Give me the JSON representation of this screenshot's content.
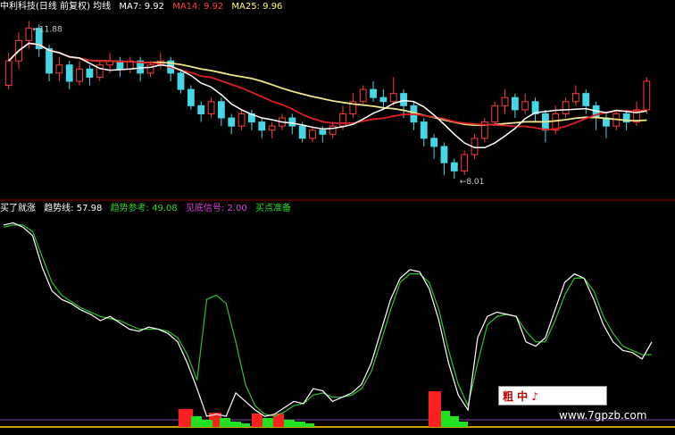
{
  "header": {
    "title": "中利科技(日线 前复权) 均线",
    "ma7": "MA7: 9.92",
    "ma14": "MA14: 9.92",
    "ma25": "MA25: 9.96",
    "high_label": "11.88",
    "low_label": "8.01"
  },
  "indicator_header": {
    "name": "买了就涨",
    "trend_line": "趋势线: 57.98",
    "trend_ref": "趋势参考: 49.08",
    "signal": "见底信号: 2.00",
    "buy_prepare": "买点准备"
  },
  "watermark": {
    "logo": "粗 中 ♪",
    "url": "www.7gpzb.com"
  },
  "colors": {
    "up": "#ff3b3b",
    "down": "#45d7e6",
    "ma7": "#ffffff",
    "ma14": "#e02020",
    "ma25": "#f0e68c",
    "trend_line": "#ffffff",
    "trend_ref": "#30c030",
    "signal_red": "#ff2020",
    "signal_green": "#20e020",
    "header_title": "#ffffff",
    "header_ma14": "#ff4040",
    "header_ma25": "#ffff66",
    "ind_name": "#ffffff",
    "ind_trend_ref": "#30d030",
    "ind_signal": "#e040e0",
    "ind_buy": "#20e020"
  },
  "chart_data": [
    {
      "type": "candlestick",
      "title": "中利科技(日线 前复权) 均线",
      "series": [
        {
          "name": "MA7",
          "value": 9.92
        },
        {
          "name": "MA14",
          "value": 9.92
        },
        {
          "name": "MA25",
          "value": 9.96
        }
      ],
      "annotations": [
        {
          "text": "11.88",
          "kind": "high"
        },
        {
          "text": "8.01",
          "kind": "low"
        }
      ],
      "ylim": [
        7.9,
        12.0
      ],
      "candles": [
        [
          10.3,
          10.9,
          11.1,
          10.2
        ],
        [
          10.9,
          11.4,
          11.6,
          10.7
        ],
        [
          11.4,
          11.7,
          11.88,
          11.2
        ],
        [
          11.7,
          11.2,
          11.8,
          11.0
        ],
        [
          11.2,
          10.6,
          11.3,
          10.4
        ],
        [
          10.6,
          10.8,
          11.0,
          10.4
        ],
        [
          10.8,
          10.4,
          10.9,
          10.2
        ],
        [
          10.4,
          10.7,
          10.9,
          10.3
        ],
        [
          10.7,
          10.5,
          10.8,
          10.3
        ],
        [
          10.5,
          10.8,
          10.9,
          10.4
        ],
        [
          10.8,
          10.9,
          11.1,
          10.6
        ],
        [
          10.9,
          10.7,
          11.0,
          10.5
        ],
        [
          10.7,
          10.9,
          11.0,
          10.6
        ],
        [
          10.9,
          10.6,
          11.0,
          10.4
        ],
        [
          10.6,
          10.8,
          10.9,
          10.5
        ],
        [
          10.8,
          10.9,
          11.1,
          10.7
        ],
        [
          10.9,
          10.6,
          11.0,
          10.4
        ],
        [
          10.6,
          10.2,
          10.7,
          10.1
        ],
        [
          10.2,
          9.8,
          10.3,
          9.7
        ],
        [
          9.8,
          9.6,
          9.9,
          9.4
        ],
        [
          9.6,
          9.9,
          10.0,
          9.5
        ],
        [
          9.9,
          9.5,
          10.0,
          9.3
        ],
        [
          9.5,
          9.3,
          9.6,
          9.1
        ],
        [
          9.3,
          9.6,
          9.7,
          9.2
        ],
        [
          9.6,
          9.4,
          9.7,
          9.2
        ],
        [
          9.4,
          9.2,
          9.5,
          9.0
        ],
        [
          9.2,
          9.3,
          9.4,
          9.0
        ],
        [
          9.3,
          9.5,
          9.6,
          9.2
        ],
        [
          9.5,
          9.3,
          9.6,
          9.1
        ],
        [
          9.3,
          9.0,
          9.4,
          8.9
        ],
        [
          9.0,
          9.2,
          9.3,
          8.9
        ],
        [
          9.2,
          9.1,
          9.3,
          8.9
        ],
        [
          9.1,
          9.3,
          9.4,
          9.0
        ],
        [
          9.3,
          9.6,
          9.8,
          9.2
        ],
        [
          9.6,
          9.9,
          10.1,
          9.5
        ],
        [
          9.9,
          10.2,
          10.3,
          9.8
        ],
        [
          10.2,
          10.0,
          10.4,
          9.9
        ],
        [
          10.0,
          9.9,
          10.2,
          9.7
        ],
        [
          9.9,
          10.1,
          10.5,
          9.8
        ],
        [
          10.1,
          9.8,
          10.2,
          9.5
        ],
        [
          9.8,
          9.4,
          9.9,
          9.2
        ],
        [
          9.4,
          9.0,
          9.5,
          8.8
        ],
        [
          9.0,
          8.8,
          9.1,
          8.5
        ],
        [
          8.8,
          8.4,
          8.9,
          8.1
        ],
        [
          8.4,
          8.2,
          8.5,
          8.01
        ],
        [
          8.2,
          8.6,
          8.7,
          8.1
        ],
        [
          8.6,
          9.0,
          9.1,
          8.5
        ],
        [
          9.0,
          9.4,
          9.5,
          8.9
        ],
        [
          9.4,
          9.8,
          9.9,
          9.3
        ],
        [
          9.8,
          10.0,
          10.2,
          9.6
        ],
        [
          10.0,
          9.7,
          10.1,
          9.5
        ],
        [
          9.7,
          9.9,
          10.1,
          9.6
        ],
        [
          9.9,
          9.6,
          10.0,
          9.4
        ],
        [
          9.6,
          9.2,
          9.7,
          8.9
        ],
        [
          9.2,
          9.6,
          9.8,
          9.1
        ],
        [
          9.6,
          9.9,
          10.0,
          9.5
        ],
        [
          9.9,
          10.1,
          10.3,
          9.8
        ],
        [
          10.1,
          9.8,
          10.2,
          9.6
        ],
        [
          9.8,
          9.5,
          9.9,
          9.2
        ],
        [
          9.5,
          9.3,
          9.6,
          9.0
        ],
        [
          9.3,
          9.6,
          9.7,
          9.2
        ],
        [
          9.6,
          9.4,
          9.7,
          9.2
        ],
        [
          9.4,
          9.7,
          9.9,
          9.3
        ],
        [
          9.7,
          10.4,
          10.5,
          9.6
        ]
      ]
    },
    {
      "type": "line",
      "title": "买了就涨",
      "series": [
        {
          "name": "趋势线",
          "value": 57.98
        },
        {
          "name": "趋势参考",
          "value": 49.08
        },
        {
          "name": "见底信号",
          "value": 2.0
        },
        {
          "name": "买点准备"
        }
      ],
      "ylim": [
        0,
        100
      ],
      "trend": [
        95,
        96,
        94,
        90,
        75,
        64,
        60,
        58,
        55,
        53,
        50,
        52,
        49,
        46,
        45,
        47,
        46,
        44,
        40,
        30,
        18,
        5,
        6,
        5,
        16,
        12,
        8,
        5,
        6,
        9,
        12,
        11,
        18,
        17,
        12,
        14,
        16,
        20,
        30,
        45,
        60,
        70,
        74,
        73,
        65,
        50,
        30,
        15,
        8,
        42,
        52,
        54,
        53,
        52,
        40,
        38,
        42,
        55,
        68,
        72,
        70,
        60,
        48,
        40,
        36,
        35,
        32,
        40
      ],
      "trend_ref": [
        94,
        95,
        95,
        92,
        80,
        68,
        62,
        59,
        56,
        54,
        52,
        51,
        50,
        48,
        46,
        46,
        46,
        45,
        42,
        34,
        22,
        60,
        62,
        58,
        40,
        20,
        10,
        6,
        5,
        7,
        10,
        11,
        15,
        16,
        14,
        14,
        15,
        18,
        26,
        40,
        55,
        68,
        72,
        72,
        68,
        55,
        36,
        20,
        10,
        30,
        48,
        52,
        53,
        52,
        45,
        40,
        40,
        50,
        62,
        70,
        70,
        64,
        52,
        44,
        38,
        36,
        34,
        34
      ]
    }
  ]
}
